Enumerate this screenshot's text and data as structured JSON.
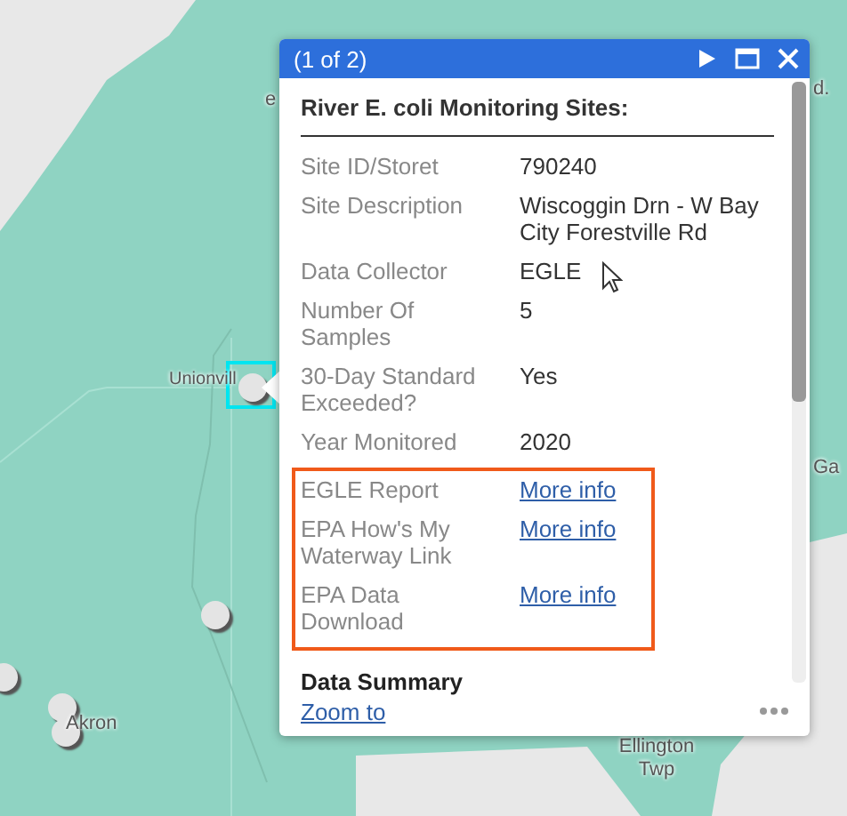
{
  "map": {
    "labels": [
      {
        "kind": "town",
        "text": "Unionvill"
      },
      {
        "kind": "town",
        "text": "Akron"
      },
      {
        "kind": "town",
        "text": "Ellington Twp"
      },
      {
        "kind": "town",
        "text": "Ga"
      },
      {
        "kind": "town",
        "text": "d."
      },
      {
        "kind": "town",
        "text": "e"
      }
    ]
  },
  "popup": {
    "pager": "(1 of 2)",
    "title": "River E. coli Monitoring Sites:",
    "fields": [
      {
        "label": "Site ID/Storet",
        "value": "790240",
        "kind": "text",
        "highlighted": false
      },
      {
        "label": "Site Description",
        "value": "Wiscoggin Drn - W Bay City Forestville Rd",
        "kind": "text",
        "highlighted": false
      },
      {
        "label": "Data Collector",
        "value": "EGLE",
        "kind": "text",
        "highlighted": false
      },
      {
        "label": "Number Of Samples",
        "value": "5",
        "kind": "text",
        "highlighted": false
      },
      {
        "label": "30-Day Standard Exceeded?",
        "value": "Yes",
        "kind": "text",
        "highlighted": false
      },
      {
        "label": "Year Monitored",
        "value": "2020",
        "kind": "text",
        "highlighted": false
      },
      {
        "label": "EGLE Report",
        "value": "More info",
        "kind": "link",
        "highlighted": true
      },
      {
        "label": "EPA How's My Waterway Link",
        "value": "More info",
        "kind": "link",
        "highlighted": true
      },
      {
        "label": "EPA Data Download",
        "value": "More info",
        "kind": "link",
        "highlighted": true
      }
    ],
    "section": "Data Summary",
    "zoom_link": "Zoom to"
  }
}
